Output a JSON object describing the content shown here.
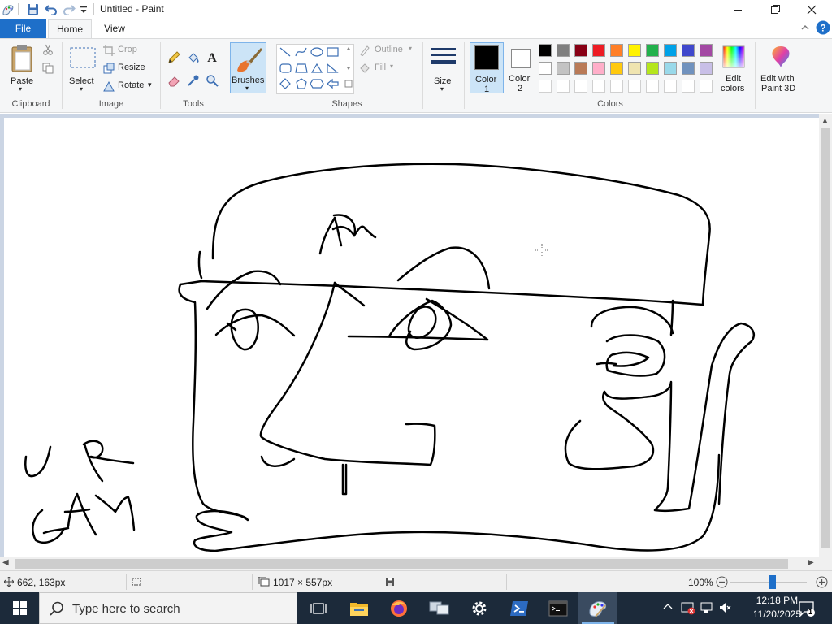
{
  "window": {
    "title": "Untitled - Paint"
  },
  "tabs": {
    "file": "File",
    "home": "Home",
    "view": "View"
  },
  "ribbon": {
    "clipboard": {
      "paste": "Paste",
      "label": "Clipboard"
    },
    "image": {
      "select": "Select",
      "crop": "Crop",
      "resize": "Resize",
      "rotate": "Rotate",
      "label": "Image"
    },
    "tools": {
      "label": "Tools"
    },
    "brushes": {
      "label": "Brushes"
    },
    "shapes": {
      "outline": "Outline",
      "fill": "Fill",
      "label": "Shapes"
    },
    "size": {
      "label": "Size"
    },
    "color1": {
      "label_line1": "Color",
      "label_line2": "1",
      "color": "#000000"
    },
    "color2": {
      "label_line1": "Color",
      "label_line2": "2",
      "color": "#ffffff"
    },
    "colors": {
      "label": "Colors",
      "row1": [
        "#000000",
        "#7f7f7f",
        "#880015",
        "#ed1c24",
        "#ff7f27",
        "#fff200",
        "#22b14c",
        "#00a2e8",
        "#3f48cc",
        "#a349a4"
      ],
      "row2": [
        "#ffffff",
        "#c3c3c3",
        "#b97a57",
        "#ffaec9",
        "#ffc90e",
        "#efe4b0",
        "#b5e61d",
        "#99d9ea",
        "#7092be",
        "#c8bfe7"
      ]
    },
    "edit_colors": {
      "line1": "Edit",
      "line2": "colors"
    },
    "paint3d": {
      "line1": "Edit with",
      "line2": "Paint 3D"
    }
  },
  "status": {
    "cursor_pos": "662, 163px",
    "image_size": "1017 × 557px",
    "zoom": "100%"
  },
  "taskbar": {
    "search_placeholder": "Type here to search",
    "time": "12:18 PM",
    "date": "11/20/2025",
    "notification_count": "1"
  }
}
